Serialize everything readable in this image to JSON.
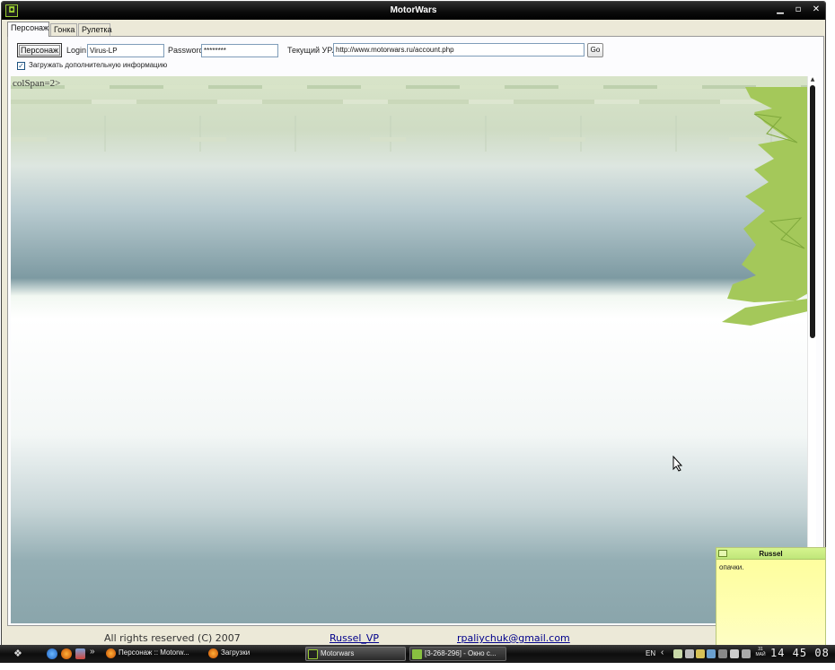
{
  "window": {
    "title": "MotorWars"
  },
  "tabs": [
    {
      "label": "Персонаж"
    },
    {
      "label": "Гонка"
    },
    {
      "label": "Рулетка"
    }
  ],
  "toolbar": {
    "character_button": "Персонаж",
    "login_label": "Login",
    "login_value": "Virus-LP",
    "password_label": "Password",
    "password_value": "********",
    "url_label": "Текущий УРЛ",
    "url_value": "http://www.motorwars.ru/account.php",
    "go_button": "Go",
    "load_extra_checkbox": {
      "label": "Загружать дополнительную информацию",
      "checked": true
    }
  },
  "browser": {
    "content_text": "colSpan=2>"
  },
  "footer": {
    "copyright": "All rights reserved (C) 2007",
    "author_link": "Russel_VP",
    "email_link": "rpaliychuk@gmail.com"
  },
  "notification": {
    "sender": "Russel",
    "message": "опачки."
  },
  "taskbar": {
    "more_glyph": "»",
    "tasks": [
      {
        "label": "Персонаж :: Motorw...",
        "icon": "firefox-icon"
      },
      {
        "label": "Загрузки",
        "icon": "firefox-icon"
      },
      {
        "label": "Motorwars",
        "icon": "motorwars-icon",
        "active": true
      },
      {
        "label": "[3-268-296] - Окно с...",
        "icon": "chat-icon"
      }
    ],
    "language": "EN",
    "date_day": "31",
    "date_month": "МАЙ",
    "clock": "14 45 08"
  },
  "colors": {
    "title_bar": "#0c0c0c",
    "link": "#00008b",
    "popup_header": "#c8ee84",
    "popup_body": "#ffffb0",
    "leaf_green": "#a4c85a"
  }
}
